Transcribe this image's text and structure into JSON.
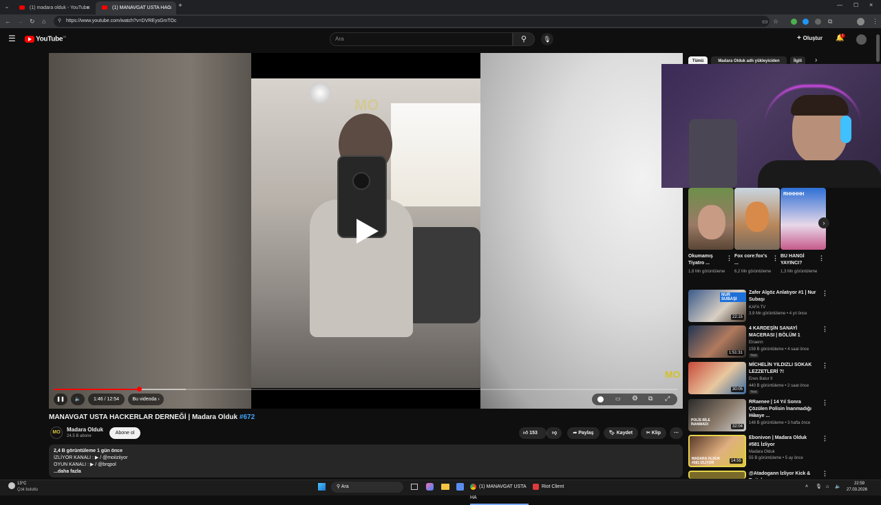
{
  "browser": {
    "tabs": [
      {
        "title": "(1) madara olduk - YouTube"
      },
      {
        "title": "(1) MANAVGAT USTA HAC"
      }
    ],
    "url": "https://www.youtube.com/watch?v=DVREysGmTOc"
  },
  "header": {
    "logo": "YouTube",
    "region": "TR",
    "search_placeholder": "Ara",
    "create_label": "Oluştur",
    "notif_count": "1"
  },
  "player": {
    "time": "1:46 / 12:54",
    "chapter": "Bu videoda",
    "watermark": "MO",
    "progress_played": 0.137,
    "progress_buffered": 0.212
  },
  "video": {
    "title": "MANAVGAT USTA HACKERLAR DERNEĞİ | Madara Olduk",
    "hashtag": "#672",
    "channel": "Madara Olduk",
    "subs": "24,5 B abone",
    "subscribe": "Abone ol",
    "likes": "153",
    "share": "Paylaş",
    "save": "Kaydet",
    "clip": "Klip",
    "description": {
      "stats": "2,4 B görüntüleme  1 gün önce",
      "line1": "İZLİYOR KANALI :  ▶ / @moiiziiyor",
      "line2": "OYUN KANALI :  ▶ / @brqpol",
      "more": "...daha fazla"
    }
  },
  "sidebar": {
    "chips": [
      "Tümü",
      "Madara Olduk adlı yükleyiciden",
      "İlgili"
    ],
    "shorts": [
      {
        "title": "Okumamış Tiyatro ...",
        "views": "1,8 Mn görüntüleme"
      },
      {
        "title": "Fox core:fox's ...",
        "views": "6,2 Mn görüntüleme"
      },
      {
        "title": "BU HANGİ YAYINCI?",
        "views": "1,3 Mn görüntüleme",
        "thumb_text": "RHHHHH"
      }
    ],
    "videos": [
      {
        "title": "Zafer Algöz Anlatıyor #1 | Nur Subaşı",
        "channel": "KAFA TV",
        "meta": "3,9 Mn görüntüleme • 4 yıl önce",
        "duration": "22:15",
        "thumb_text": "NUR SUBAŞI",
        "badge": ""
      },
      {
        "title": "4 KARDEŞİN SANAYİ MACERASI | BÖLÜM 1",
        "channel": "Elraenn",
        "meta": "159 B görüntüleme • 4 saat önce",
        "duration": "1:51:31",
        "thumb_text": "",
        "badge": "Yeni"
      },
      {
        "title": "MİCHELİN YILDIZLI SOKAK LEZZETLERİ ?!",
        "channel": "Enes Batur ll",
        "meta": "440 B görüntüleme • 2 saat önce",
        "duration": "30:05",
        "thumb_text": "",
        "badge": "Yeni"
      },
      {
        "title": "RRaenee | 14 Yıl Sonra Çözülen Polisin İnanmadığı Hikaye ...",
        "channel": "2kan",
        "meta": "148 B görüntüleme • 3 hafta önce",
        "duration": "32:04",
        "thumb_text": "POLİS BİLE İNANMADI",
        "badge": ""
      },
      {
        "title": "Ebonivon | Madara Olduk #581 İzliyor",
        "channel": "Madara Olduk",
        "meta": "55 B görüntüleme • 5 ay önce",
        "duration": "14:55",
        "thumb_text": "MADARA OLDUK #581 İZLİYOR",
        "badge": ""
      },
      {
        "title": "@Atadogann İzliyor Kick & Twitch...",
        "channel": "",
        "meta": "",
        "duration": "",
        "thumb_text": "",
        "badge": ""
      }
    ]
  },
  "taskbar": {
    "weather_temp": "13°C",
    "weather_desc": "Çok bulutlu",
    "search": "Ara",
    "app1": "(1) MANAVGAT USTA HA",
    "app2": "Riot Client",
    "time": "22:59",
    "date": "27.03.2026"
  },
  "colors": {
    "accent": "#ff0000",
    "hashtag": "#3ea6ff",
    "watermark": "#d4c12a"
  }
}
